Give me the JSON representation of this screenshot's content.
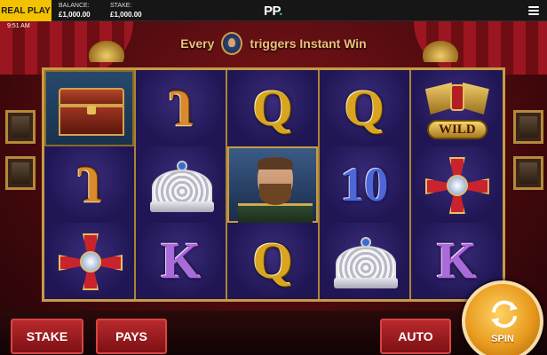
{
  "topbar": {
    "mode_label": "REAL PLAY",
    "balance_label": "BALANCE:",
    "balance_value": "£1,000.00",
    "stake_label": "STAKE:",
    "stake_value": "£1,000.00",
    "logo_text": "PP",
    "logo_dot": ".",
    "menu_icon": "hamburger-menu-icon"
  },
  "clock": "9:51 AM",
  "banner": {
    "text_left": "Every",
    "text_right": "triggers Instant Win",
    "seal_icon": "tsar-seal-icon"
  },
  "reels": [
    [
      {
        "type": "chest"
      },
      {
        "type": "letter",
        "text": "J",
        "style": "orange"
      },
      {
        "type": "cross"
      }
    ],
    [
      {
        "type": "letter",
        "text": "J",
        "style": "orange"
      },
      {
        "type": "crown"
      },
      {
        "type": "letter",
        "text": "K",
        "style": "purple"
      }
    ],
    [
      {
        "type": "letter",
        "text": "Q",
        "style": "gold"
      },
      {
        "type": "tsar"
      },
      {
        "type": "letter",
        "text": "Q",
        "style": "gold"
      }
    ],
    [
      {
        "type": "letter",
        "text": "Q",
        "style": "gold"
      },
      {
        "type": "letter",
        "text": "10",
        "style": "blue"
      },
      {
        "type": "crown"
      }
    ],
    [
      {
        "type": "wild",
        "text": "WILD"
      },
      {
        "type": "cross"
      },
      {
        "type": "letter",
        "text": "K",
        "style": "purple"
      }
    ]
  ],
  "buttons": {
    "stake": "STAKE",
    "pays": "PAYS",
    "auto": "AUTO",
    "spin": "SPIN"
  },
  "colors": {
    "accent_yellow": "#f2c200",
    "button_red": "#b8292d",
    "spin_orange": "#e89a1c",
    "reel_bg": "#241656",
    "gold_frame": "#c79b45"
  }
}
